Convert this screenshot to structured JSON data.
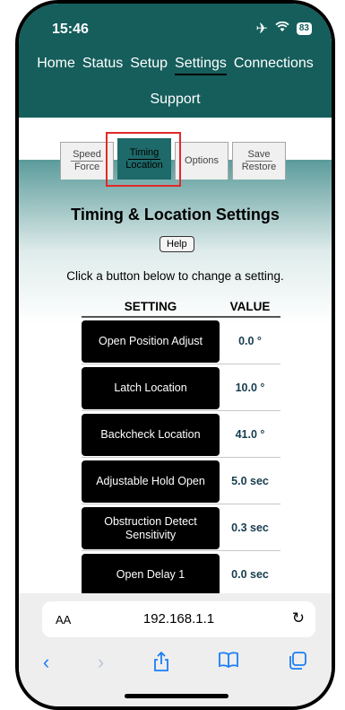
{
  "status": {
    "time": "15:46",
    "battery": "83"
  },
  "nav": {
    "items": [
      "Home",
      "Status",
      "Setup",
      "Settings",
      "Connections"
    ],
    "second": "Support",
    "active": "Settings"
  },
  "tabs": [
    {
      "l1": "Speed",
      "l2": "Force"
    },
    {
      "l1": "Timing",
      "l2": "Location"
    },
    {
      "l1": "Options",
      "l2": ""
    },
    {
      "l1": "Save",
      "l2": "Restore"
    }
  ],
  "page": {
    "title": "Timing & Location Settings",
    "help": "Help",
    "instruction": "Click a button below to change a setting."
  },
  "table": {
    "headers": [
      "SETTING",
      "VALUE"
    ],
    "rows": [
      {
        "setting": "Open Position Adjust",
        "value": "0.0 °"
      },
      {
        "setting": "Latch Location",
        "value": "10.0 °"
      },
      {
        "setting": "Backcheck Location",
        "value": "41.0 °"
      },
      {
        "setting": "Adjustable Hold Open",
        "value": "5.0 sec"
      },
      {
        "setting": "Obstruction Detect Sensitivity",
        "value": "0.3 sec"
      },
      {
        "setting": "Open Delay 1",
        "value": "0.0 sec"
      }
    ]
  },
  "browser": {
    "aa": "AA",
    "url": "192.168.1.1"
  },
  "colors": {
    "header": "#155e5c",
    "active_tab": "#1e6969",
    "highlight": "#e12929",
    "link": "#1a7ef5"
  }
}
